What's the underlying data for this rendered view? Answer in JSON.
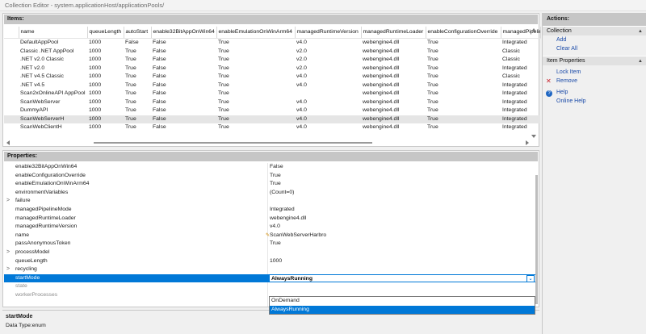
{
  "window": {
    "title": "Collection Editor - system.applicationHost/applicationPools/"
  },
  "items": {
    "header": "Items:",
    "columns": [
      "name",
      "queueLength",
      "autoStart",
      "enable32BitAppOnWin64",
      "enableConfigurationOverride",
      "enableEmulationOnWinArm64",
      "managedRuntimeVersion",
      "managedRuntimeLoader",
      "enableConfigurationOverride",
      "managedPipelin"
    ],
    "rows": [
      [
        "DefaultAppPool",
        "1000",
        "False",
        "False",
        "True",
        "v4.0",
        "webengine4.dll",
        "True",
        "Integrated"
      ],
      [
        "Classic .NET AppPool",
        "1000",
        "True",
        "False",
        "True",
        "v2.0",
        "webengine4.dll",
        "True",
        "Classic"
      ],
      [
        ".NET v2.0 Classic",
        "1000",
        "True",
        "False",
        "True",
        "v2.0",
        "webengine4.dll",
        "True",
        "Classic"
      ],
      [
        ".NET v2.0",
        "1000",
        "True",
        "False",
        "True",
        "v2.0",
        "webengine4.dll",
        "True",
        "Integrated"
      ],
      [
        ".NET v4.5 Classic",
        "1000",
        "True",
        "False",
        "True",
        "v4.0",
        "webengine4.dll",
        "True",
        "Classic"
      ],
      [
        ".NET v4.5",
        "1000",
        "True",
        "False",
        "True",
        "v4.0",
        "webengine4.dll",
        "True",
        "Integrated"
      ],
      [
        "Scan2xOnlineAPI AppPool",
        "1000",
        "True",
        "False",
        "True",
        "",
        "webengine4.dll",
        "True",
        "Integrated"
      ],
      [
        "ScanWebServer",
        "1000",
        "True",
        "False",
        "True",
        "v4.0",
        "webengine4.dll",
        "True",
        "Integrated"
      ],
      [
        "DummyAPI",
        "1000",
        "True",
        "False",
        "True",
        "v4.0",
        "webengine4.dll",
        "True",
        "Integrated"
      ],
      [
        "ScanWebServerH",
        "1000",
        "True",
        "False",
        "True",
        "v4.0",
        "webengine4.dll",
        "True",
        "Integrated"
      ],
      [
        "ScanWebClientH",
        "1000",
        "True",
        "False",
        "True",
        "v4.0",
        "webengine4.dll",
        "True",
        "Integrated"
      ]
    ]
  },
  "properties": {
    "header": "Properties:",
    "rows": [
      {
        "name": "enable32BitAppOnWin64",
        "value": "False",
        "exp": ""
      },
      {
        "name": "enableConfigurationOverride",
        "value": "True",
        "exp": ""
      },
      {
        "name": "enableEmulationOnWinArm64",
        "value": "True",
        "exp": ""
      },
      {
        "name": "environmentVariables",
        "value": "(Count=0)",
        "exp": ""
      },
      {
        "name": "failure",
        "value": "",
        "exp": ">"
      },
      {
        "name": "managedPipelineMode",
        "value": "Integrated",
        "exp": ""
      },
      {
        "name": "managedRuntimeLoader",
        "value": "webengine4.dll",
        "exp": ""
      },
      {
        "name": "managedRuntimeVersion",
        "value": "v4.0",
        "exp": ""
      },
      {
        "name": "name",
        "value": "ScanWebServerHarbro",
        "exp": ""
      },
      {
        "name": "passAnonymousToken",
        "value": "True",
        "exp": ""
      },
      {
        "name": "processModel",
        "value": "",
        "exp": ">"
      },
      {
        "name": "queueLength",
        "value": "1000",
        "exp": ""
      },
      {
        "name": "recycling",
        "value": "",
        "exp": ">"
      },
      {
        "name": "startMode",
        "value": "AlwaysRunning",
        "exp": ""
      },
      {
        "name": "state",
        "value": "",
        "exp": ""
      },
      {
        "name": "workerProcesses",
        "value": "",
        "exp": ""
      }
    ],
    "dropdown_options": [
      "OnDemand",
      "AlwaysRunning"
    ]
  },
  "description": {
    "title": "startMode",
    "text": "Data Type:enum"
  },
  "actions": {
    "header": "Actions:",
    "collection_group": "Collection",
    "add": "Add",
    "clear_all": "Clear All",
    "item_props_group": "Item Properties",
    "lock_item": "Lock Item",
    "remove": "Remove",
    "help": "Help",
    "online_help": "Online Help"
  },
  "colors": {
    "selection": "#0078d7",
    "link": "#1a4aa8",
    "header": "#c6c6c6"
  }
}
